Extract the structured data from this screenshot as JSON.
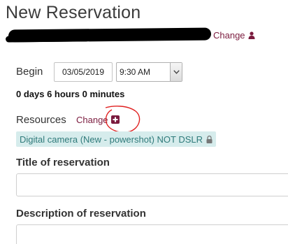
{
  "page": {
    "title": "New Reservation"
  },
  "user": {
    "change_label": "Change"
  },
  "schedule": {
    "begin_label": "Begin",
    "date": "03/05/2019",
    "time": "9:30 AM",
    "duration": "0 days 6 hours 0 minutes"
  },
  "resources": {
    "label": "Resources",
    "change_label": "Change",
    "items": [
      {
        "name": "Digital camera (New - powershot) NOT DSLR"
      }
    ]
  },
  "reservation_title": {
    "label": "Title of reservation",
    "value": ""
  },
  "reservation_description": {
    "label": "Description of reservation",
    "value": ""
  },
  "colors": {
    "link": "#7b1b3e",
    "resource_tag_bg": "#d6ecec",
    "resource_tag_text": "#2f7a7a",
    "annotation": "#e02020"
  },
  "icons": {
    "user": "user-icon",
    "add": "plus-square-icon",
    "lock": "lock-icon",
    "dropdown": "chevron-down-icon"
  }
}
